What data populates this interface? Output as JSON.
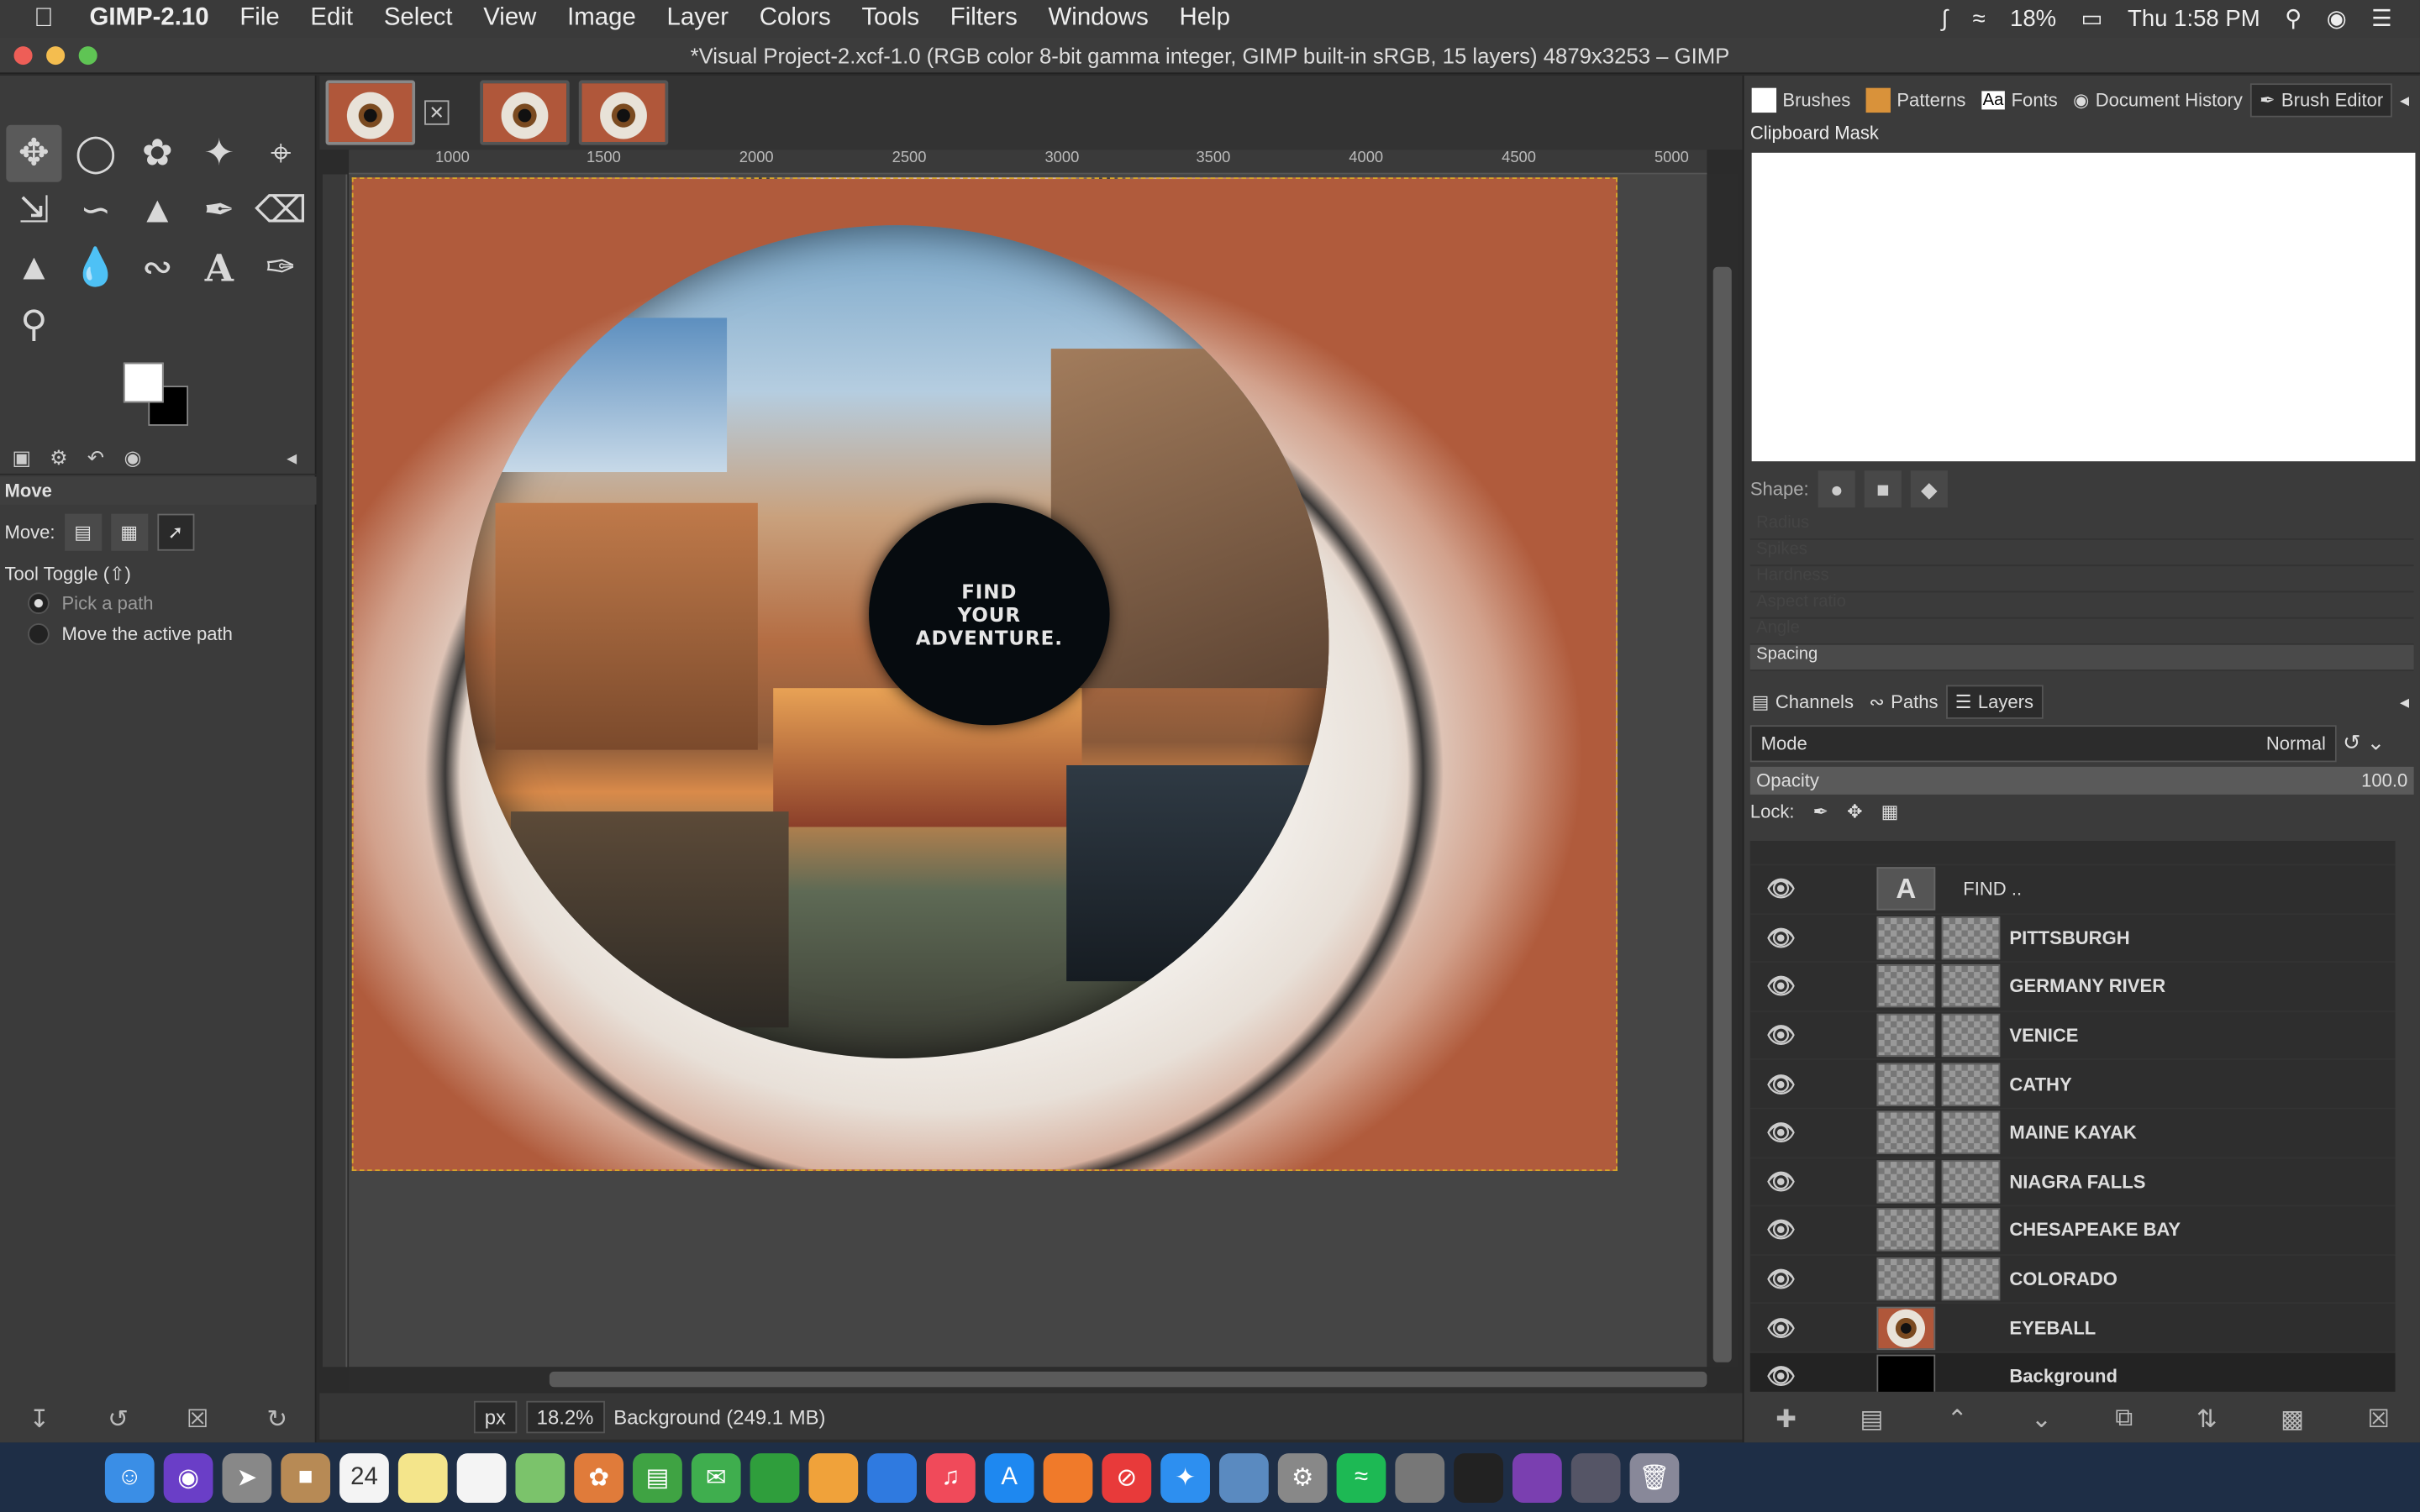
{
  "menubar": {
    "app_name": "GIMP-2.10",
    "items": [
      "File",
      "Edit",
      "Select",
      "View",
      "Image",
      "Layer",
      "Colors",
      "Tools",
      "Filters",
      "Windows",
      "Help"
    ],
    "battery": "18%",
    "clock": "Thu 1:58 PM"
  },
  "window": {
    "title": "*Visual Project-2.xcf-1.0 (RGB color 8-bit gamma integer, GIMP built-in sRGB, 15 layers) 4879x3253 – GIMP"
  },
  "tool_options": {
    "title": "Move",
    "move_label": "Move:",
    "tool_toggle": "Tool Toggle  (⇧)",
    "option_pick": "Pick a path",
    "option_move": "Move the active path"
  },
  "ruler": {
    "marks": [
      "1000",
      "1500",
      "2000",
      "2500",
      "3000",
      "3500",
      "4000",
      "4500",
      "5000"
    ]
  },
  "canvas": {
    "pupil_text_line1": "FIND",
    "pupil_text_line2": "YOUR",
    "pupil_text_line3": "ADVENTURE."
  },
  "statusbar": {
    "unit": "px",
    "zoom": "18.2%",
    "info": "Background (249.1 MB)"
  },
  "dock_top": {
    "tabs": [
      "Brushes",
      "Patterns",
      "Fonts",
      "Document History",
      "Brush Editor"
    ],
    "panel_title": "Clipboard Mask",
    "shape_label": "Shape:",
    "sliders": [
      "Radius",
      "Spikes",
      "Hardness",
      "Aspect ratio",
      "Angle",
      "Spacing"
    ]
  },
  "dock_bottom": {
    "tabs": [
      "Channels",
      "Paths",
      "Layers"
    ],
    "mode_label": "Mode",
    "mode_value": "Normal",
    "opacity_label": "Opacity",
    "opacity_value": "100.0",
    "lock_label": "Lock:",
    "layers": [
      {
        "name": "FIND ..",
        "type": "text"
      },
      {
        "name": "PITTSBURGH",
        "type": "image"
      },
      {
        "name": "GERMANY RIVER",
        "type": "image"
      },
      {
        "name": "VENICE",
        "type": "image"
      },
      {
        "name": "CATHY",
        "type": "image"
      },
      {
        "name": "MAINE KAYAK",
        "type": "image"
      },
      {
        "name": "NIAGRA FALLS",
        "type": "image"
      },
      {
        "name": "CHESAPEAKE BAY",
        "type": "image"
      },
      {
        "name": "COLORADO",
        "type": "image"
      },
      {
        "name": "EYEBALL",
        "type": "eye"
      },
      {
        "name": "Background",
        "type": "background"
      }
    ]
  }
}
